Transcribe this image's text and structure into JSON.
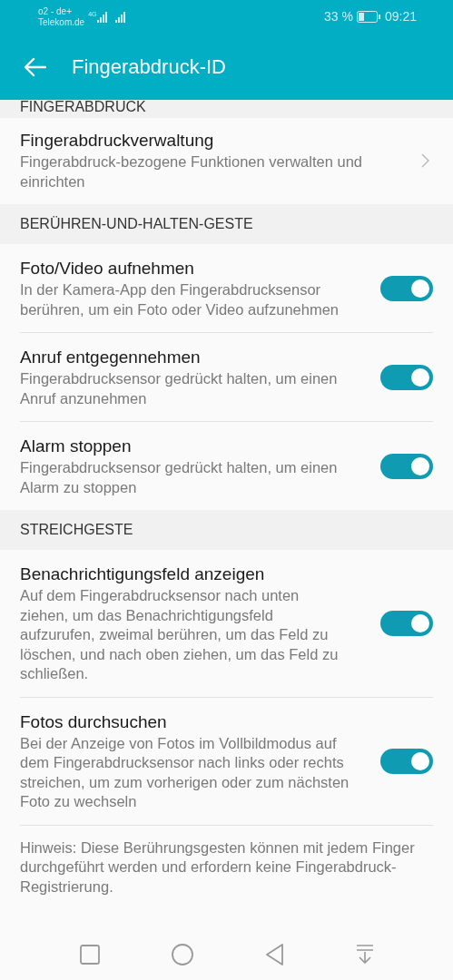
{
  "status_bar": {
    "carrier_line_1": "o2 - de+",
    "carrier_line_2": "Telekom.de",
    "network": "4G",
    "battery_percent": "33 %",
    "time": "09:21"
  },
  "app_bar": {
    "title": "Fingerabdruck-ID"
  },
  "sections": [
    {
      "header": "FINGERABDRUCK",
      "items": [
        {
          "kind": "link",
          "title": "Fingerabdruckverwaltung",
          "subtitle": "Fingerabdruck-bezogene Funktionen verwalten und einrichten"
        }
      ]
    },
    {
      "header": "BERÜHREN-UND-HALTEN-GESTE",
      "items": [
        {
          "kind": "switch",
          "title": "Foto/Video aufnehmen",
          "subtitle": "In der Kamera-App den Fingerabdrucksensor berühren, um ein Foto oder Video aufzunehmen",
          "on": true
        },
        {
          "kind": "switch",
          "title": "Anruf entgegennehmen",
          "subtitle": "Fingerabdrucksensor gedrückt halten, um einen Anruf anzunehmen",
          "on": true
        },
        {
          "kind": "switch",
          "title": "Alarm stoppen",
          "subtitle": "Fingerabdrucksensor gedrückt halten, um einen Alarm zu stoppen",
          "on": true
        }
      ]
    },
    {
      "header": "STREICHGESTE",
      "items": [
        {
          "kind": "switch",
          "title": "Benachrichtigungsfeld anzeigen",
          "subtitle": "Auf dem Fingerabdrucksensor nach unten ziehen, um das Benachrichtigungsfeld aufzurufen, zweimal berühren, um das Feld zu löschen, und nach oben ziehen, um das Feld zu schließen.",
          "on": true
        },
        {
          "kind": "switch",
          "title": "Fotos durchsuchen",
          "subtitle": "Bei der Anzeige von Fotos im Vollbildmodus auf dem Fingerabdrucksensor nach links oder rechts streichen, um zum vorherigen oder zum nächsten Foto zu wechseln",
          "on": true
        }
      ]
    }
  ],
  "note": "Hinweis: Diese Berührungsgesten können mit jedem Finger durchgeführt werden und erfordern keine Fingerabdruck-Registrierung."
}
